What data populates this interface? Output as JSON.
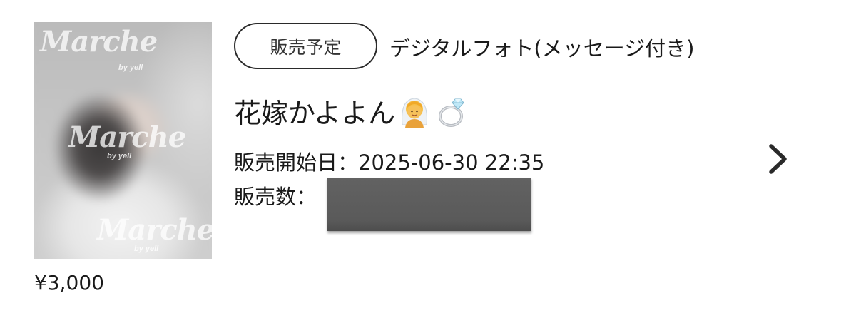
{
  "item": {
    "watermark": "Marche",
    "watermark_sub": "by yell",
    "price": "¥3,000",
    "status": "販売予定",
    "category": "デジタルフォト(メッセージ付き)",
    "title": "花嫁かよよん",
    "title_emojis": [
      "bride-with-veil-icon",
      "ring-icon"
    ],
    "sale_start_label": "販売開始日：",
    "sale_start_value": "2025-06-30 22:35",
    "sales_count_label": "販売数：",
    "sales_count_value": "",
    "sales_count_redacted": true
  },
  "colors": {
    "text": "#1a1a1a",
    "badge_border": "#2a2a2a",
    "redaction": "#5e5e5e",
    "background": "#ffffff"
  }
}
